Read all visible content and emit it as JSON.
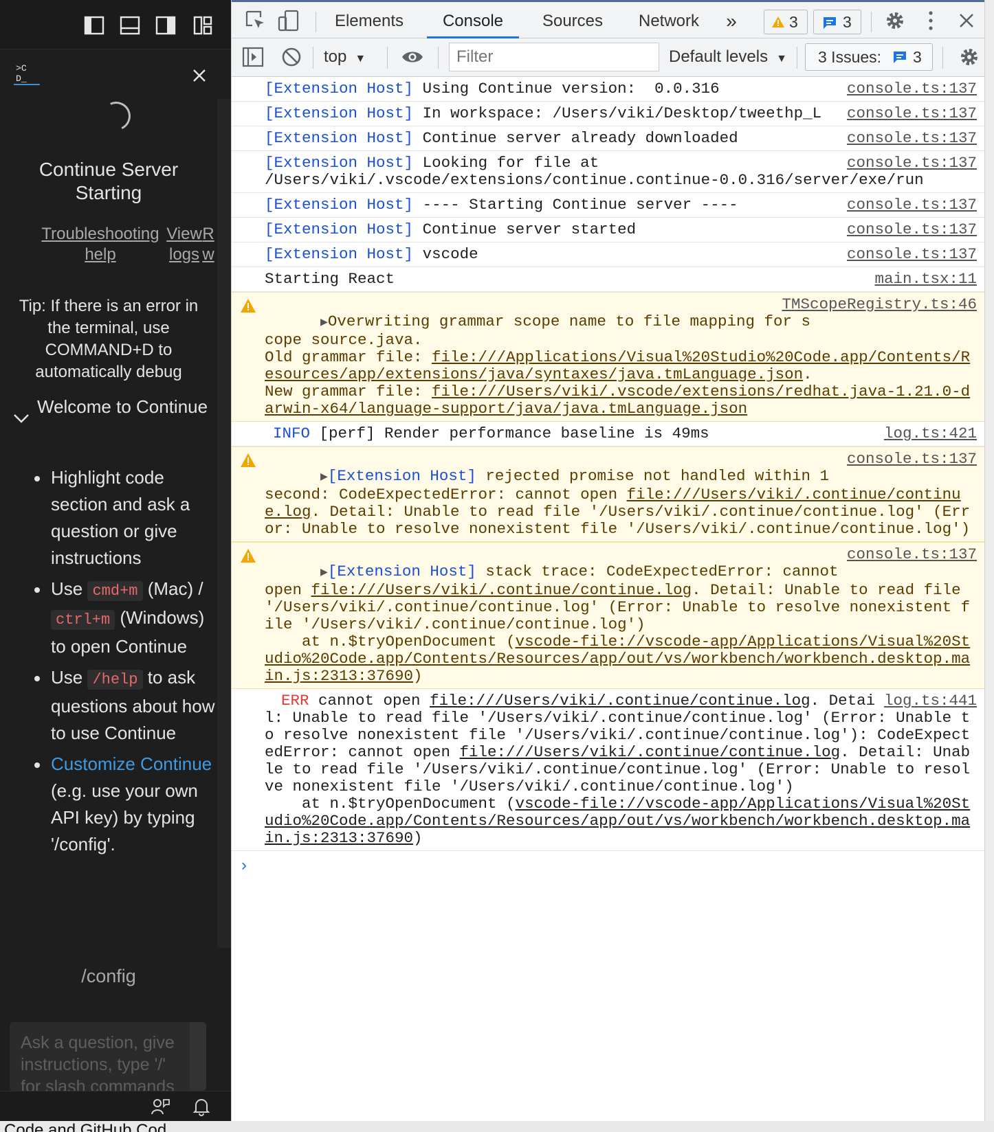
{
  "sidebar": {
    "server_title": "Continue Server Starting",
    "troubleshooting_link": "Troubleshooting help",
    "view_logs_link": "View logs",
    "overflow_link": "R w",
    "tip": "Tip: If there is an error in the terminal, use COMMAND+D to automatically debug",
    "welcome_title": "Welcome to Continue",
    "welcome_items": {
      "i0": "Highlight code section and ask a question or give instructions",
      "i1_a": "Use",
      "i1_kbd1": "cmd+m",
      "i1_b": "(Mac) /",
      "i1_kbd2": "ctrl+m",
      "i1_c": "(Windows) to open Continue",
      "i2_a": "Use",
      "i2_kbd": "/help",
      "i2_b": "to ask questions about how to use Continue",
      "i3_link": "Customize Continue",
      "i3_b": "(e.g. use your own API key) by typing '/config'."
    },
    "config_cmd": "/config",
    "ask_placeholder": "Ask a question, give instructions, type '/' for slash commands"
  },
  "devtools": {
    "tabs": [
      "Elements",
      "Console",
      "Sources",
      "Network"
    ],
    "active_tab": "Console",
    "more_tabs": "»",
    "warnings_count": "3",
    "messages_count": "3",
    "context": "top",
    "filter_placeholder": "Filter",
    "levels": "Default levels",
    "issues_label": "3 Issues:",
    "issues_count": "3"
  },
  "console": {
    "host": "[Extension Host]",
    "m1": {
      "text": "Using Continue version:  0.0.316",
      "src": "console.ts:137"
    },
    "m2": {
      "text": "In workspace:  /Users/viki/Desktop/tweethp_L",
      "src": "console.ts:137"
    },
    "m3": {
      "text": "Continue server already downloaded",
      "src": "console.ts:137"
    },
    "m4": {
      "text": "Looking for file at",
      "text2": "/Users/viki/.vscode/extensions/continue.continue-0.0.316/server/exe/run",
      "src": "console.ts:137"
    },
    "m5": {
      "text": "---- Starting Continue server ----",
      "src": "console.ts:137"
    },
    "m6": {
      "text": "Continue server started",
      "src": "console.ts:137"
    },
    "m7": {
      "text": "vscode",
      "src": "console.ts:137"
    },
    "m8": {
      "text": "Starting React",
      "src": "main.tsx:11"
    },
    "w1": {
      "text": "Overwriting grammar scope name to file mapping for scope source.java.",
      "old_label": "Old grammar file: ",
      "old_link": "file:///Applications/Visual%20Studio%20Code.app/Contents/Resources/app/extensions/java/syntaxes/java.tmLanguage.json",
      "new_label": "New grammar file: ",
      "new_link": "file:///Users/viki/.vscode/extensions/redhat.java-1.21.0-darwin-x64/language-support/java/java.tmLanguage.json",
      "src": "TMScopeRegistry.ts:46"
    },
    "info": {
      "level": "INFO",
      "text": "[perf] Render performance baseline is 49ms",
      "src": "log.ts:421"
    },
    "w2": {
      "text": "rejected promise not handled within 1 second: CodeExpectedError: cannot open ",
      "link": "file:///Users/viki/.continue/continue.log",
      "text2": ". Detail: Unable to read file '/Users/viki/.continue/continue.log' (Error: Unable to resolve nonexistent file '/Users/viki/.continue/continue.log')",
      "src": "console.ts:137"
    },
    "w3": {
      "text": "stack trace: CodeExpectedError: cannot open ",
      "link": "file:///Users/viki/.continue/continue.log",
      "text2": ". Detail: Unable to read file '/Users/viki/.continue/continue.log' (Error: Unable to resolve nonexistent file '/Users/viki/.continue/continue.log')",
      "at": "    at n.$tryOpenDocument (",
      "at_link": "vscode-file://vscode-app/Applications/Visual%20Studio%20Code.app/Contents/Resources/app/out/vs/workbench/workbench.desktop.main.js:2313:37690",
      "src": "console.ts:137"
    },
    "err": {
      "level": "ERR",
      "text": "cannot open ",
      "link": "file:///Users/viki/.continue/continue.log",
      "text2": ". Detail: Unable to read file '/Users/viki/.continue/continue.log' (Error: Unable to resolve nonexistent file '/Users/viki/.continue/continue.log'): CodeExpectedError: cannot open ",
      "link2": "file:///Users/viki/.continue/continue.log",
      "text3": ". Detail: Unable to read file '/Users/viki/.continue/continue.log' (Error: Unable to resolve nonexistent file '/Users/viki/.continue/continue.log')",
      "at": "    at n.$tryOpenDocument (",
      "at_link": "vscode-file://vscode-app/Applications/Visual%20Studio%20Code.app/Contents/Resources/app/out/vs/workbench/workbench.desktop.main.js:2313:37690",
      "src": "log.ts:441"
    },
    "prompt": "›"
  },
  "bottom_text": "e Code and GitHub Cod"
}
